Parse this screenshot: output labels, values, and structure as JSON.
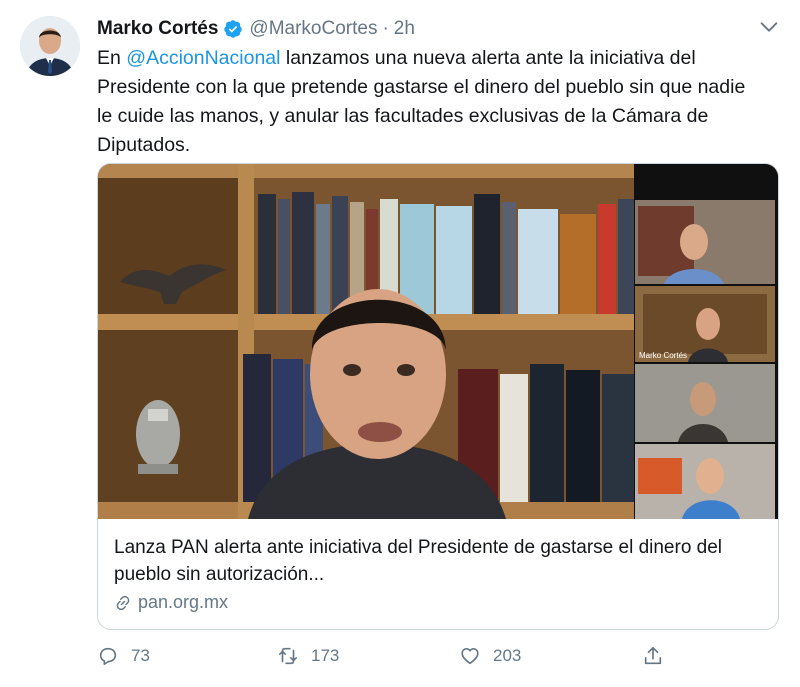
{
  "tweet": {
    "author": {
      "display_name": "Marko Cortés",
      "handle": "@MarkoCortes",
      "verified_icon": "verified-badge-icon"
    },
    "separator": "·",
    "time": "2h",
    "text": {
      "prefix": "En ",
      "mention": "@AccionNacional",
      "body": " lanzamos una nueva alerta ante la iniciativa del Presidente con la que pretende gastarse el dinero del pueblo sin que nadie le cuide las manos, y anular las facultades exclusivas de la Cámara de Diputados."
    },
    "card": {
      "video_overlay_name": "Marko Cortés",
      "title": "Lanza PAN alerta ante iniciativa del Presidente de gastarse el dinero del pueblo sin autorización...",
      "domain": "pan.org.mx"
    },
    "actions": {
      "replies": "73",
      "retweets": "173",
      "likes": "203"
    },
    "colors": {
      "accent": "#1b95e0",
      "muted": "#657786",
      "text": "#14171a",
      "border": "#ccd6dd"
    }
  }
}
